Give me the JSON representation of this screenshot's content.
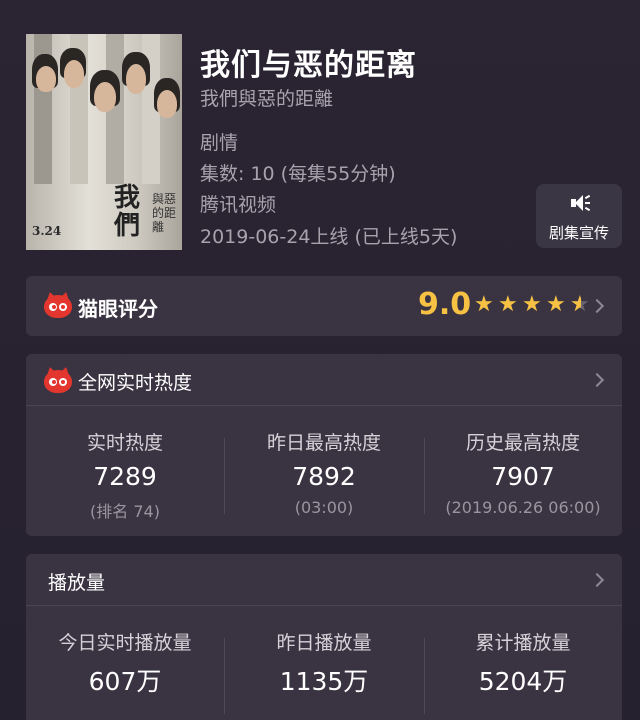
{
  "show": {
    "title": "我们与恶的距离",
    "subtitle": "我們與惡的距離",
    "genre": "剧情",
    "episodes": "集数: 10  (每集55分钟)",
    "platform": "腾讯视频",
    "release": "2019-06-24上线 (已上线5天)"
  },
  "poster": {
    "title_text": "我們",
    "sub_text": "與惡的距離",
    "date_text": "3.24"
  },
  "promo": {
    "label": "剧集宣传",
    "icon": "speaker-icon"
  },
  "rating": {
    "label": "猫眼评分",
    "score": "9.0",
    "stars": 4.5,
    "accent": "#f7c244",
    "icon": "cat-logo-icon"
  },
  "heat": {
    "label": "全网实时热度",
    "icon": "cat-logo-icon",
    "columns": [
      {
        "label": "实时热度",
        "value": "7289",
        "sub": "(排名 74)"
      },
      {
        "label": "昨日最高热度",
        "value": "7892",
        "sub": "(03:00)"
      },
      {
        "label": "历史最高热度",
        "value": "7907",
        "sub": "(2019.06.26 06:00)"
      }
    ]
  },
  "plays": {
    "label": "播放量",
    "columns": [
      {
        "label": "今日实时播放量",
        "value": "607万"
      },
      {
        "label": "昨日播放量",
        "value": "1135万"
      },
      {
        "label": "累计播放量",
        "value": "5204万"
      }
    ]
  },
  "colors": {
    "background": "#27222f",
    "card": "#3a3442",
    "brand_red": "#e2362f"
  }
}
